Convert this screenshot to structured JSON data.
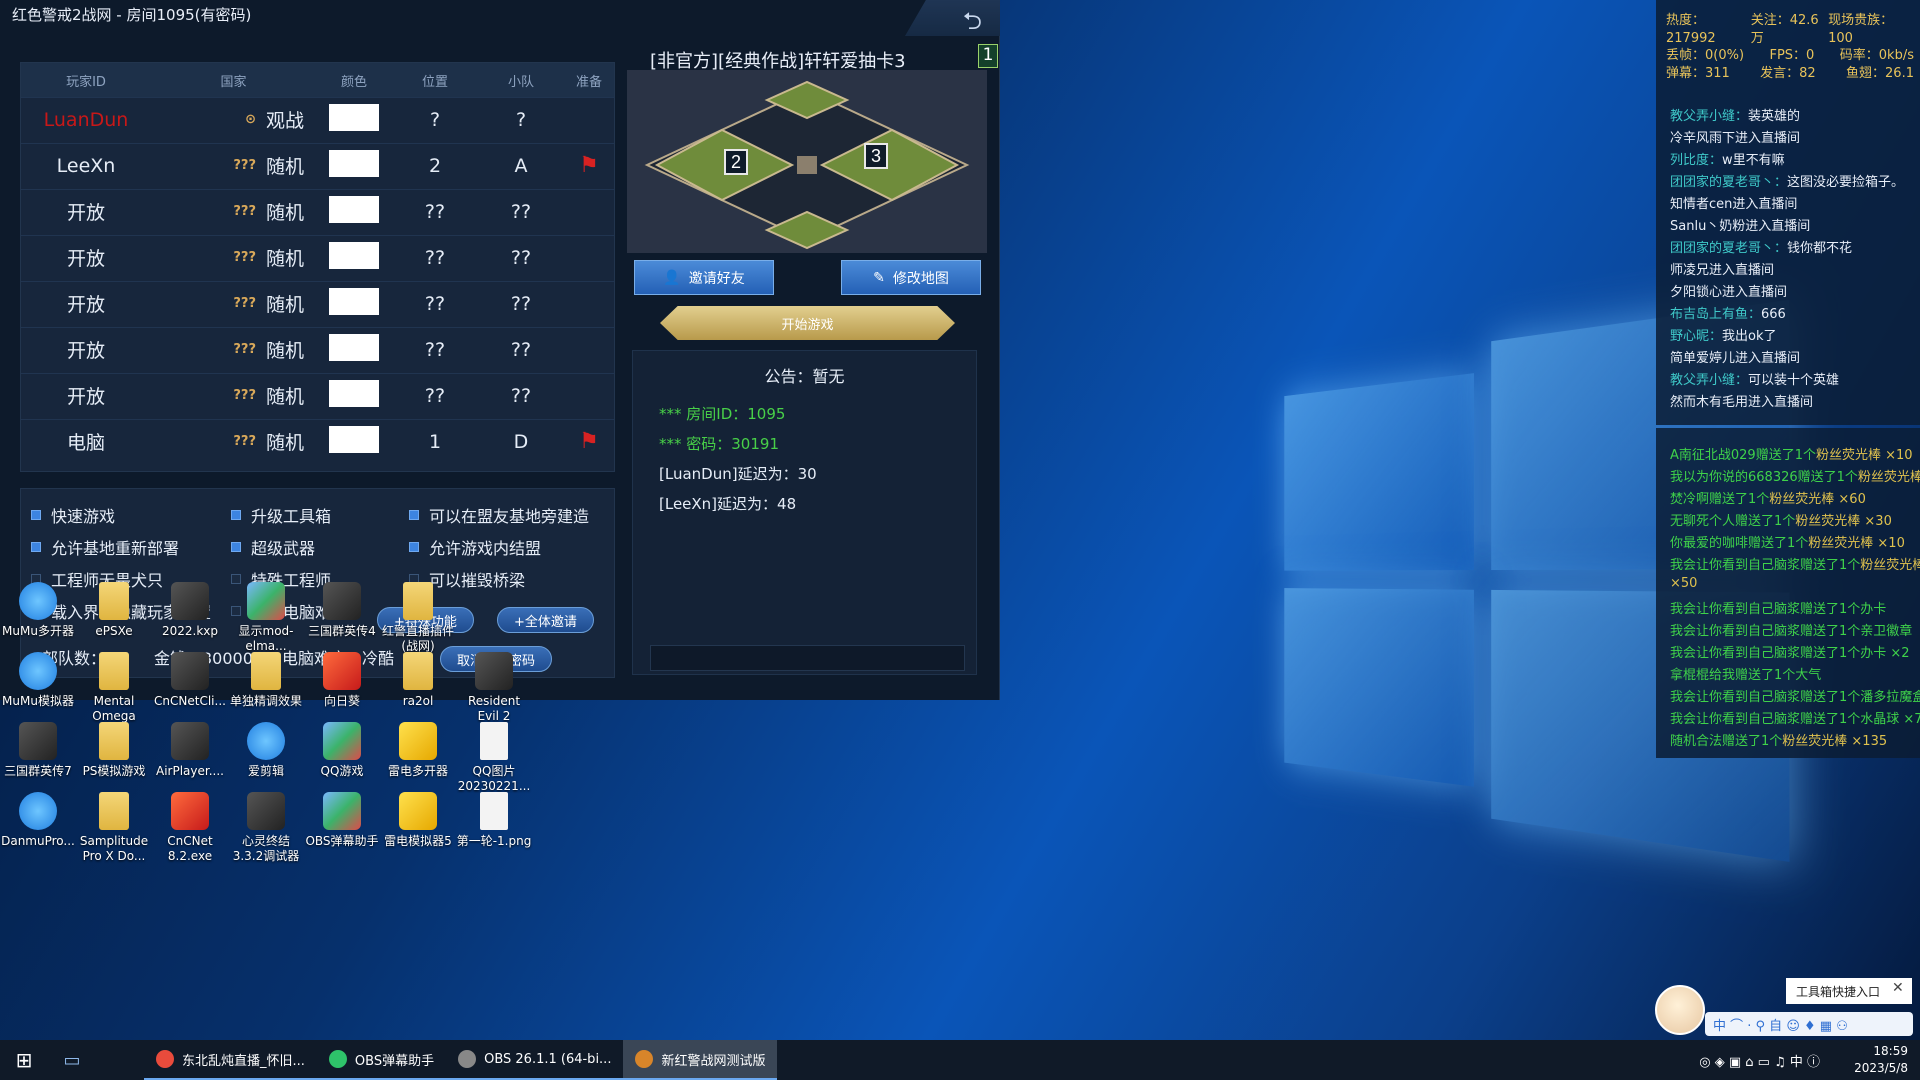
{
  "window": {
    "title": "红色警戒2战网 - 房间1095(有密码)",
    "back_icon": "⮌"
  },
  "table": {
    "headers": [
      "玩家ID",
      "国家",
      "颜色",
      "位置",
      "小队",
      "准备"
    ],
    "rows": [
      {
        "id": "LuanDun",
        "nation": "观战",
        "nation_icon": "⊙",
        "pos": "?",
        "team": "?",
        "ready": ""
      },
      {
        "id": "LeeXn",
        "nation": "随机",
        "nation_icon": "???",
        "pos": "2",
        "team": "A",
        "ready": "⚑"
      },
      {
        "id": "开放",
        "nation": "随机",
        "nation_icon": "???",
        "pos": "??",
        "team": "??",
        "ready": ""
      },
      {
        "id": "开放",
        "nation": "随机",
        "nation_icon": "???",
        "pos": "??",
        "team": "??",
        "ready": ""
      },
      {
        "id": "开放",
        "nation": "随机",
        "nation_icon": "???",
        "pos": "??",
        "team": "??",
        "ready": ""
      },
      {
        "id": "开放",
        "nation": "随机",
        "nation_icon": "???",
        "pos": "??",
        "team": "??",
        "ready": ""
      },
      {
        "id": "开放",
        "nation": "随机",
        "nation_icon": "???",
        "pos": "??",
        "team": "??",
        "ready": ""
      },
      {
        "id": "电脑",
        "nation": "随机",
        "nation_icon": "???",
        "pos": "1",
        "team": "D",
        "ready": "⚑"
      }
    ]
  },
  "options": {
    "quick_game": "快速游戏",
    "crate": "升级工具箱",
    "build_near_ally": "可以在盟友基地旁建造",
    "redeploy": "允许基地重新部署",
    "superweapon": "超级武器",
    "ingame_ally": "允许游戏内结盟",
    "no_dog": "工程师无畏犬只",
    "special_engineer": "特殊工程师",
    "destroy_bridge": "可以摧毁桥梁",
    "hide_pos": "载入界面隐藏玩家位置",
    "ai_hard": "增加电脑难度",
    "special_btn": "+特殊功能",
    "invite_all_btn": "+全体邀请",
    "cancel_pwd_btn": "取消房间密码",
    "units": "部队数：10",
    "money": "金钱：30000",
    "ai_level": "电脑难度：冷酷"
  },
  "room": {
    "title": "[非官方][经典作战]轩轩爱抽卡3",
    "number": "1",
    "map_start_2": "2",
    "map_start_3": "3",
    "invite_btn": "邀请好友",
    "edit_map_btn": "修改地图",
    "start_btn": "开始游戏",
    "notice_title": "公告：暂无",
    "room_id": "*** 房间ID：1095",
    "password": "*** 密码：30191",
    "latency_1": "[LuanDun]延迟为：30",
    "latency_2": "[LeeXn]延迟为：48"
  },
  "desktop": [
    {
      "label": "MuMu多开器",
      "kind": "blue"
    },
    {
      "label": "ePSXe",
      "kind": "folder"
    },
    {
      "label": "2022.kxp",
      "kind": "dark"
    },
    {
      "label": "显示mod-elma...",
      "kind": "mix"
    },
    {
      "label": "三国群英传4",
      "kind": "dark"
    },
    {
      "label": "红警直播插件(战网)",
      "kind": "folder"
    },
    {
      "label": "MuMu模拟器",
      "kind": "blue"
    },
    {
      "label": "Mental Omega",
      "kind": "folder"
    },
    {
      "label": "CnCNetCli...",
      "kind": "dark"
    },
    {
      "label": "单独精调效果",
      "kind": "folder"
    },
    {
      "label": "向日葵",
      "kind": "red"
    },
    {
      "label": "ra2ol",
      "kind": "folder"
    },
    {
      "label": "Resident Evil 2",
      "kind": "dark"
    },
    {
      "label": "三国群英传7",
      "kind": "dark"
    },
    {
      "label": "PS模拟游戏",
      "kind": "folder"
    },
    {
      "label": "AirPlayer....",
      "kind": "dark"
    },
    {
      "label": "爱剪辑",
      "kind": "blue"
    },
    {
      "label": "QQ游戏",
      "kind": "mix"
    },
    {
      "label": "雷电多开器",
      "kind": "yellow"
    },
    {
      "label": "QQ图片20230221...",
      "kind": "file"
    },
    {
      "label": "DanmuPro...",
      "kind": "blue"
    },
    {
      "label": "Samplitude Pro X Do...",
      "kind": "folder"
    },
    {
      "label": "CnCNet 8.2.exe",
      "kind": "red"
    },
    {
      "label": "心灵终结3.3.2调试器",
      "kind": "dark"
    },
    {
      "label": "OBS弹幕助手",
      "kind": "mix"
    },
    {
      "label": "雷电模拟器5",
      "kind": "yellow"
    },
    {
      "label": "第一轮-1.png",
      "kind": "file"
    }
  ],
  "danmu": {
    "stats": {
      "heat": "热度：217992",
      "follow": "关注：42.6万",
      "nobles": "现场贵族：100",
      "drop": "丢帧：0(0%)",
      "fps": "FPS：0",
      "bitrate": "码率：0kb/s",
      "bullets": "弹幕：311",
      "speak": "发言：82",
      "fish": "鱼翅：26.1"
    },
    "messages": [
      {
        "name": "教父弄小缝：",
        "text": "装英雄的"
      },
      {
        "name": "",
        "text": "冷辛风雨下进入直播间"
      },
      {
        "name": "列比度：",
        "text": "w里不有嘛"
      },
      {
        "name": "团团家的夏老哥丶：",
        "text": "这图没必要捡箱子。"
      },
      {
        "name": "",
        "text": "知情者cen进入直播间"
      },
      {
        "name": "",
        "text": "Sanlu丶奶粉进入直播间"
      },
      {
        "name": "团团家的夏老哥丶：",
        "text": "钱你都不花"
      },
      {
        "name": "",
        "text": "师凌兄进入直播间"
      },
      {
        "name": "",
        "text": "夕阳锁心进入直播间"
      },
      {
        "name": "布吉岛上有鱼：",
        "text": "666"
      },
      {
        "name": "野心昵：",
        "text": "我出ok了"
      },
      {
        "name": "",
        "text": "简单爱婷儿进入直播间"
      },
      {
        "name": "教父弄小缝：",
        "text": "可以装十个英雄"
      },
      {
        "name": "",
        "text": "然而木有毛用进入直播间"
      }
    ],
    "gifts": [
      {
        "text": "A南征北战029赠送了1个",
        "item": "粉丝荧光棒 ×10"
      },
      {
        "text": "我以为你说的668326赠送了1个",
        "item": "粉丝荧光棒"
      },
      {
        "text": "焚冷啊赠送了1个",
        "item": "粉丝荧光棒 ×60"
      },
      {
        "text": "无聊死个人赠送了1个",
        "item": "粉丝荧光棒 ×30"
      },
      {
        "text": "你最爱的咖啡赠送了1个",
        "item": "粉丝荧光棒 ×10"
      },
      {
        "text": "我会让你看到自己脑浆赠送了1个",
        "item": "粉丝荧光棒"
      },
      {
        "text": "",
        "item": "×50"
      },
      {
        "text": "我会让你看到自己脑浆赠送了1个办卡",
        "item": ""
      },
      {
        "text": "我会让你看到自己脑浆赠送了1个亲卫徽章",
        "item": ""
      },
      {
        "text": "我会让你看到自己脑浆赠送了1个办卡 ×2",
        "item": ""
      },
      {
        "text": "拿棍棍给我赠送了1个大气",
        "item": ""
      },
      {
        "text": "我会让你看到自己脑浆赠送了1个潘多拉魔盒",
        "item": ""
      },
      {
        "text": "我会让你看到自己脑浆赠送了1个水晶球 ×7",
        "item": ""
      },
      {
        "text": "随机合法赠送了1个",
        "item": "粉丝荧光棒 ×135"
      }
    ],
    "toolbox": "工具箱快捷入口",
    "tool_strip": "中 ⌒ · ⚲ 自 ☺ ♦ ▦ ⚇"
  },
  "taskbar": {
    "apps": [
      {
        "label": "东北乱炖直播_怀旧...",
        "color": "#e94b3c"
      },
      {
        "label": "OBS弹幕助手",
        "color": "#2ec36a"
      },
      {
        "label": "OBS 26.1.1 (64-bi...",
        "color": "#888888"
      },
      {
        "label": "新红警战网测试版",
        "color": "#d8852a"
      }
    ],
    "tray": "◎ ◈ ▣ ⌂ ▭ ♫ 中 ⓘ",
    "time": "18:59",
    "date": "2023/5/8"
  }
}
